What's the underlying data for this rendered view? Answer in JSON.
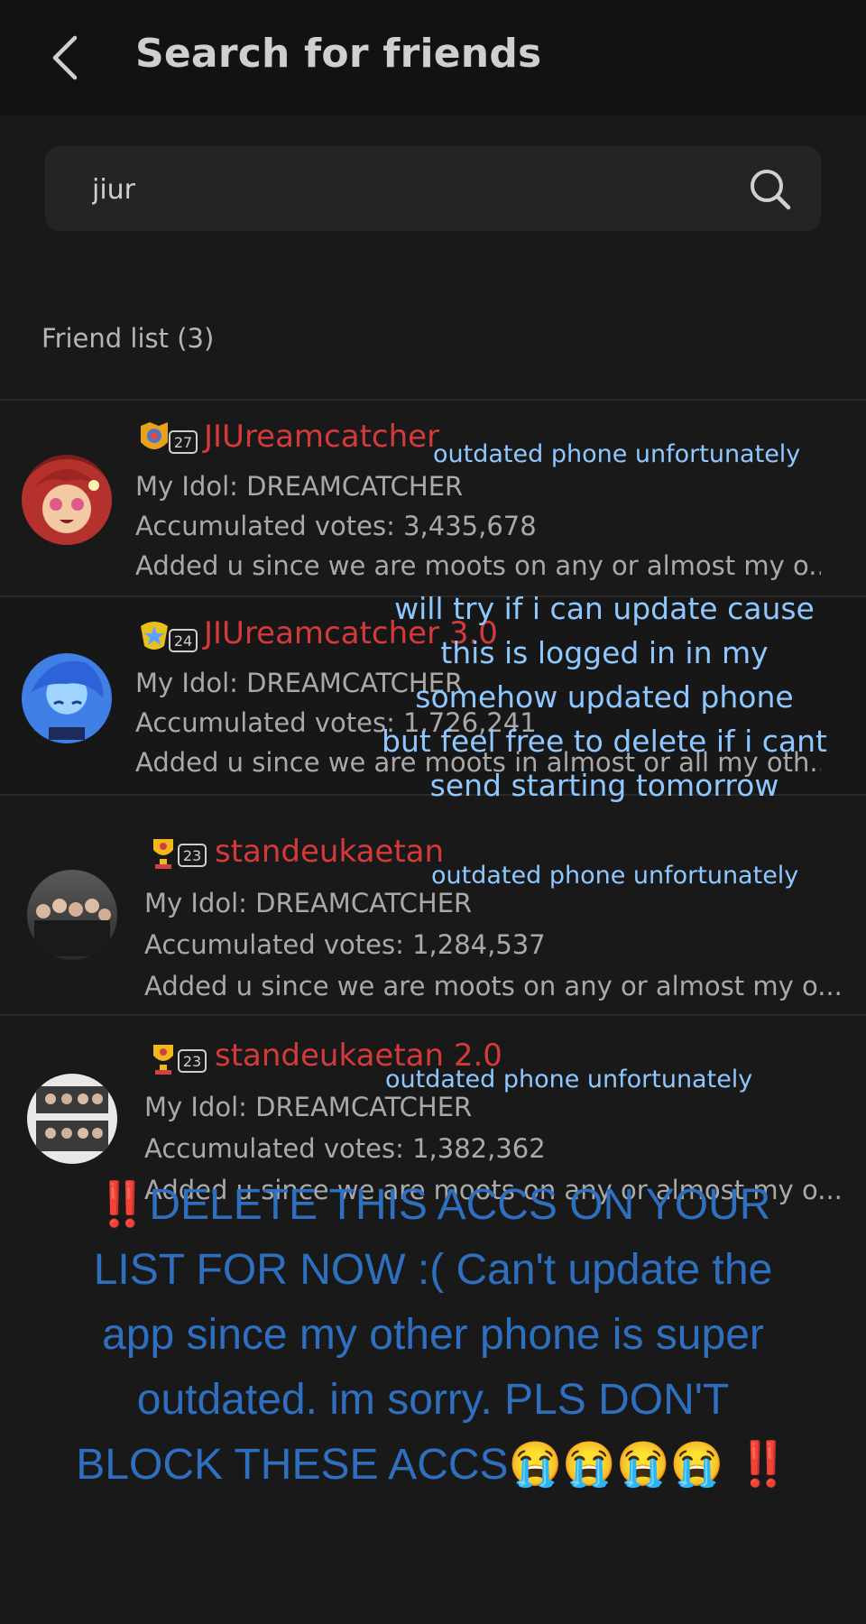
{
  "header": {
    "title": "Search for friends"
  },
  "search": {
    "value": "jiur"
  },
  "friend_list": {
    "label": "Friend list (3)",
    "items": [
      {
        "badge_level": "27",
        "name": "JIUreamcatcher",
        "idol": "My Idol: DREAMCATCHER",
        "votes": "Accumulated votes: 3,435,678",
        "note": "Added u since we are moots on any or almost my o..."
      },
      {
        "badge_level": "24",
        "name": "JIUreamcatcher 3.0",
        "idol": "My Idol: DREAMCATCHER",
        "votes": "Accumulated votes: 1,726,241",
        "note": "Added u since we are moots in almost or all my oth..."
      },
      {
        "badge_level": "23",
        "name": "standeukaetan",
        "idol": "My Idol: DREAMCATCHER",
        "votes": "Accumulated votes: 1,284,537",
        "note": "Added u since we are moots on any or almost my o..."
      },
      {
        "badge_level": "23",
        "name": "standeukaetan 2.0",
        "idol": "My Idol: DREAMCATCHER",
        "votes": "Accumulated votes: 1,382,362",
        "note": "Added u since we are moots on any or almost my o..."
      }
    ]
  },
  "overlays": {
    "outdated_1": "outdated phone unfortunately",
    "outdated_3": "outdated phone unfortunately",
    "outdated_4": "outdated phone unfortunately",
    "update_note": [
      "will try if i can update cause",
      "this is logged in in my",
      "somehow updated phone",
      "but feel free to delete if i cant",
      "send starting tomorrow"
    ],
    "big_note_lead": "‼️",
    "big_note_text": "DELETE THIS ACCS ON YOUR LIST FOR NOW :( Can't update the app since my other phone is super outdated. im sorry. PLS DON'T BLOCK THESE ACCS",
    "big_note_emojis": "😭😭😭😭",
    "big_note_end": "‼️"
  }
}
